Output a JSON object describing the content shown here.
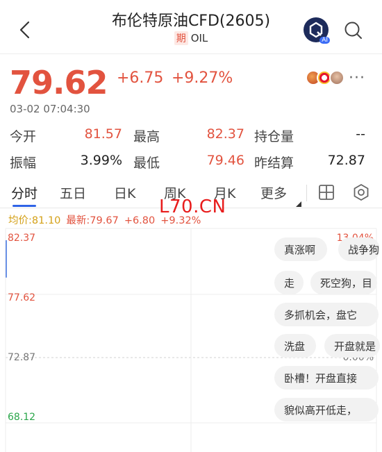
{
  "header": {
    "title": "布伦特原油CFD(2605)",
    "badge": "期",
    "subtitle": "OIL"
  },
  "quote": {
    "price": "79.62",
    "change": "+6.75",
    "change_pct": "+9.27%",
    "timestamp": "03-02 07:04:30"
  },
  "stats": {
    "row1": [
      {
        "label": "今开",
        "value": "81.57"
      },
      {
        "label": "最高",
        "value": "82.37"
      },
      {
        "label": "持仓量",
        "value": "--"
      }
    ],
    "row2": [
      {
        "label": "振幅",
        "value": "3.99%"
      },
      {
        "label": "最低",
        "value": "79.46"
      },
      {
        "label": "昨结算",
        "value": "72.87"
      }
    ]
  },
  "tabs": [
    "分时",
    "五日",
    "日K",
    "周K",
    "月K",
    "更多"
  ],
  "summary": {
    "avg": "均价:81.10",
    "latest": "最新:79.67",
    "change": "+6.80",
    "pct": "+9.32%"
  },
  "chart_data": {
    "type": "line",
    "y_ticks_left": [
      "82.37",
      "77.62",
      "72.87",
      "68.12"
    ],
    "y_ticks_right": [
      "13.04%",
      "0.00%"
    ],
    "ylim": [
      68.12,
      82.37
    ],
    "reference": 72.87,
    "series": [
      {
        "values": [
          79.62
        ]
      }
    ]
  },
  "comments": [
    "真涨啊",
    "战争狗",
    "走",
    "死空狗，目",
    "多抓机会，盘它",
    "洗盘",
    "开盘就是",
    "卧槽！开盘直接",
    "貌似高开低走，"
  ],
  "watermark": "L70.CN",
  "colors": {
    "up": "#e2533f",
    "down": "#2aa64a",
    "avg": "#d4a017",
    "accent": "#2f63e6"
  }
}
